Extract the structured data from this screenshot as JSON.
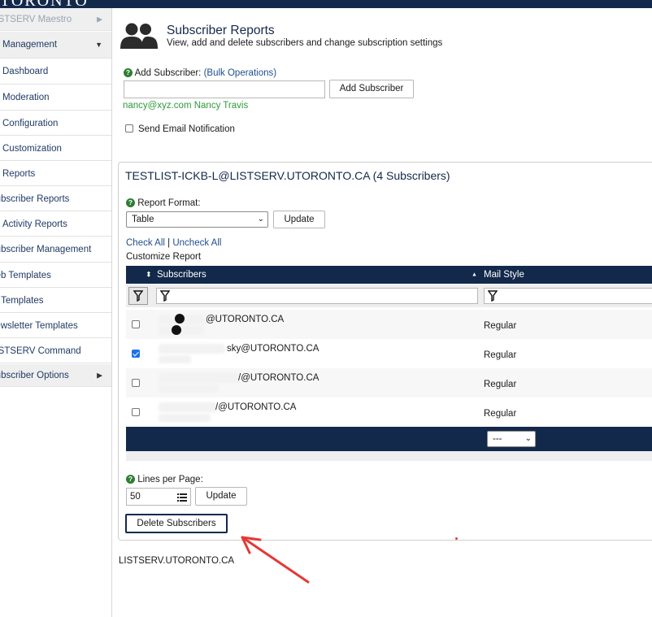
{
  "app": {
    "brand": "TORONTO"
  },
  "sidebar": {
    "items": [
      {
        "label": "LISTSERV Maestro",
        "caret": "▶"
      },
      {
        "label": "Management",
        "caret": "▼"
      },
      {
        "label": "Dashboard"
      },
      {
        "label": "Moderation"
      },
      {
        "label": "Configuration"
      },
      {
        "label": "Customization"
      },
      {
        "label": "Reports"
      },
      {
        "label": "Subscriber Reports"
      },
      {
        "label": "Activity Reports"
      },
      {
        "label": "Subscriber Management"
      },
      {
        "label": "Web Templates"
      },
      {
        "label": "Mail Templates"
      },
      {
        "label": "Newsletter Templates"
      },
      {
        "label": "LISTSERV Command"
      },
      {
        "label": "Subscriber Options",
        "caret": "▶"
      }
    ]
  },
  "header": {
    "title": "Subscriber Reports",
    "subtitle": "View, add and delete subscribers and change subscription settings",
    "icon": "users-icon"
  },
  "add_subscriber": {
    "label": "Add Subscriber:",
    "bulk_link": "(Bulk Operations)",
    "input_value": "",
    "button": "Add Subscriber",
    "example": "nancy@xyz.com Nancy Travis",
    "send_notification_label": "Send Email Notification",
    "send_notification_checked": false
  },
  "list": {
    "title": "TESTLIST-ICKB-L@LISTSERV.UTORONTO.CA (4 Subscribers)",
    "report_format_label": "Report Format:",
    "report_format_value": "Table",
    "update_button": "Update",
    "check_all": "Check All",
    "separator": "|",
    "uncheck_all": "Uncheck All",
    "customize_report": "Customize Report"
  },
  "table": {
    "columns": [
      {
        "label": "Subscribers",
        "sort_icon": "⬍"
      },
      {
        "label": "Mail Style",
        "sort_icon": "▲"
      }
    ],
    "rows": [
      {
        "email": "@UTORONTO.CA",
        "mail_style": "Regular",
        "checked": false
      },
      {
        "email": "sky@UTORONTO.CA",
        "mail_style": "Regular",
        "checked": true
      },
      {
        "email": "/@UTORONTO.CA",
        "mail_style": "Regular",
        "checked": false
      },
      {
        "email": "/@UTORONTO.CA",
        "mail_style": "Regular",
        "checked": false
      }
    ],
    "footer_select_value": "---"
  },
  "pagination": {
    "lines_label": "Lines per Page:",
    "lines_value": "50",
    "update_button": "Update"
  },
  "actions": {
    "delete_button": "Delete Subscribers"
  },
  "footer": {
    "link": "LISTSERV.UTORONTO.CA"
  },
  "colors": {
    "navy": "#13294b",
    "link": "#1f4e8c",
    "green": "#2e7d32",
    "annotation": "#e53935"
  }
}
